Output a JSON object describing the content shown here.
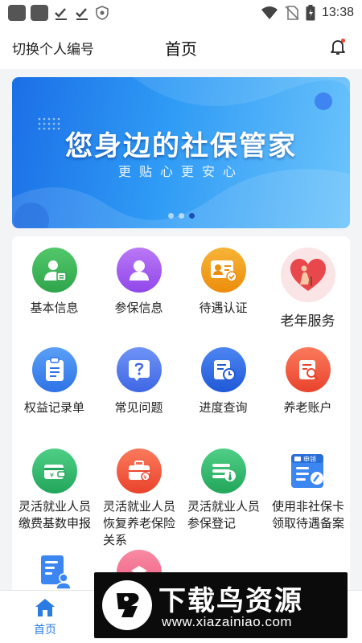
{
  "status_bar": {
    "time": "13:38"
  },
  "header": {
    "switch_label": "切换个人编号",
    "title": "首页",
    "bell_icon": "bell-icon"
  },
  "banner": {
    "title": "您身边的社保管家",
    "subtitle": "更贴心更安心",
    "slide_count": 3,
    "active_slide": 3
  },
  "services": [
    {
      "label": "基本信息",
      "icon": "person-id-icon",
      "color": "#3fb55a"
    },
    {
      "label": "参保信息",
      "icon": "person-icon",
      "color": "#a55cf0"
    },
    {
      "label": "待遇认证",
      "icon": "id-card-check-icon",
      "color": "#f0a01e"
    },
    {
      "label": "老年服务",
      "icon": "elder-heart-icon",
      "color": "#e8474c"
    },
    {
      "label": "权益记录单",
      "icon": "clipboard-icon",
      "color": "#3b86f0"
    },
    {
      "label": "常见问题",
      "icon": "question-icon",
      "color": "#4b7cf0"
    },
    {
      "label": "进度查询",
      "icon": "progress-clock-icon",
      "color": "#2f6fe0"
    },
    {
      "label": "养老账户",
      "icon": "account-search-icon",
      "color": "#f05a3c"
    },
    {
      "label": "灵活就业人员缴费基数申报",
      "icon": "wallet-yen-icon",
      "color": "#31b56b"
    },
    {
      "label": "灵活就业人员恢复养老保险关系",
      "icon": "briefcase-yen-icon",
      "color": "#f05a3c"
    },
    {
      "label": "灵活就业人员参保登记",
      "icon": "money-tie-icon",
      "color": "#2fb66a"
    },
    {
      "label": "使用非社保卡领取待遇备案",
      "icon": "application-form-icon",
      "color": "#3b86f0",
      "badge": "申领"
    },
    {
      "label": "",
      "icon": "document-person-icon",
      "color": "#3b86f0"
    },
    {
      "label": "",
      "icon": "pink-circle-icon",
      "color": "#f06a8a"
    }
  ],
  "tabbar": {
    "items": [
      {
        "label": "首页",
        "icon": "home-icon",
        "active": true
      }
    ],
    "active_color": "#2a7be4"
  },
  "watermark": {
    "title": "下载鸟资源",
    "url": "www.xiazainiao.com"
  }
}
